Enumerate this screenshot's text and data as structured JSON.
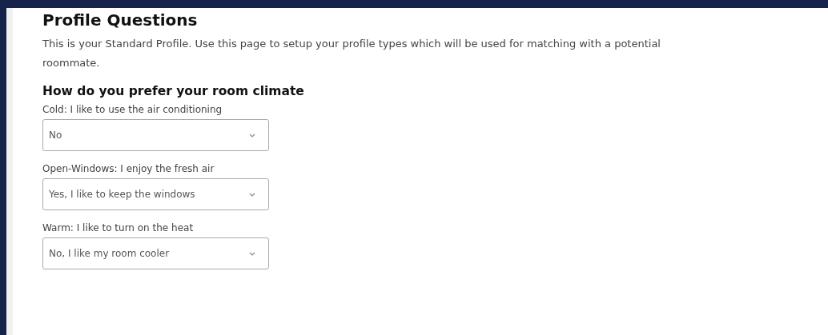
{
  "title": "Profile Questions",
  "intro": "This is your Standard Profile. Use this page to setup your profile types which will be used for matching with a potential roommate.",
  "section": {
    "heading": "How do you prefer your room climate",
    "questions": [
      {
        "label": "Cold: I like to use the air conditioning",
        "value": "No"
      },
      {
        "label": "Open-Windows: I enjoy the fresh air",
        "value": "Yes, I like to keep the windows"
      },
      {
        "label": "Warm: I like to turn on the heat",
        "value": "No, I like my room cooler"
      }
    ]
  }
}
